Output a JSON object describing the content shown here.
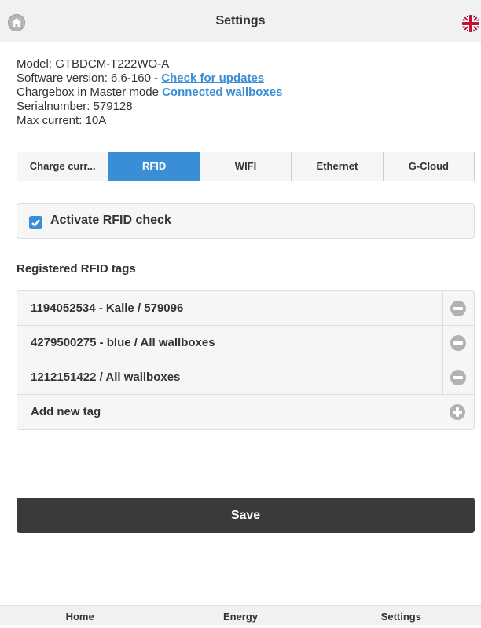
{
  "header": {
    "title": "Settings",
    "home_icon": "home-icon",
    "language_icon": "uk-flag-icon"
  },
  "info": {
    "model": "Model: GTBDCM-T222WO-A",
    "software_prefix": "Software version: 6.6-160 - ",
    "check_updates_link": "Check for updates",
    "chargebox_prefix": "Chargebox in Master mode ",
    "connected_wallboxes_link": "Connected wallboxes",
    "serial": "Serialnumber: 579128",
    "max_current": "Max current: 10A"
  },
  "tabs": [
    {
      "label": "Charge curr...",
      "active": false
    },
    {
      "label": "RFID",
      "active": true
    },
    {
      "label": "WIFI",
      "active": false
    },
    {
      "label": "Ethernet",
      "active": false
    },
    {
      "label": "G-Cloud",
      "active": false
    }
  ],
  "rfid_check": {
    "label": "Activate RFID check",
    "checked": true
  },
  "registered": {
    "title": "Registered RFID tags",
    "tags": [
      {
        "label": "1194052534 - Kalle / 579096",
        "action_icon": "remove-icon"
      },
      {
        "label": "4279500275 - blue / All wallboxes",
        "action_icon": "remove-icon"
      },
      {
        "label": "1212151422 / All wallboxes",
        "action_icon": "remove-icon"
      }
    ],
    "add_label": "Add new tag",
    "add_icon": "add-icon"
  },
  "save_label": "Save",
  "footer": [
    {
      "label": "Home"
    },
    {
      "label": "Energy"
    },
    {
      "label": "Settings"
    }
  ],
  "colors": {
    "accent": "#3a8ed5",
    "save_button": "#3a3a3a",
    "link": "#3b8ed6"
  }
}
